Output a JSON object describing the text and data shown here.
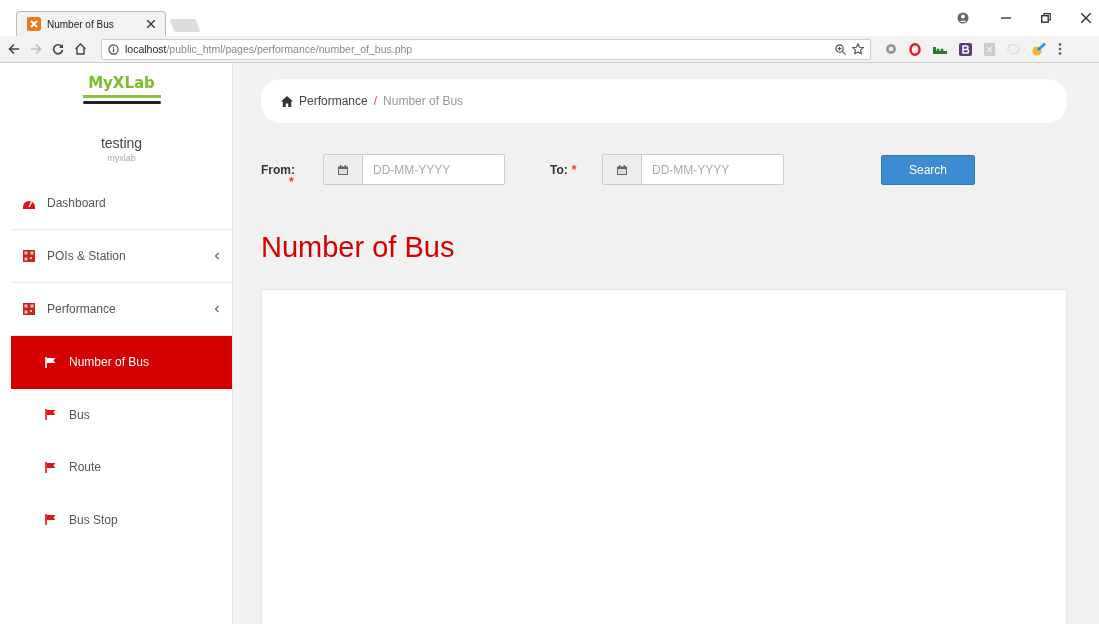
{
  "browser": {
    "tab_title": "Number of Bus",
    "url_host": "localhost",
    "url_path": "/public_html/pages/performance/number_of_bus.php"
  },
  "sidebar": {
    "logo": "MyXLab",
    "user_name": "testing",
    "user_org": "myxlab",
    "items": [
      {
        "label": "Dashboard",
        "kind": "dashboard"
      },
      {
        "label": "POIs & Station",
        "kind": "group"
      },
      {
        "label": "Performance",
        "kind": "group",
        "children": [
          {
            "label": "Number of Bus",
            "selected": true
          },
          {
            "label": "Bus",
            "selected": false
          },
          {
            "label": "Route",
            "selected": false
          },
          {
            "label": "Bus Stop",
            "selected": false
          }
        ]
      }
    ]
  },
  "breadcrumb": [
    "Performance",
    "Number of Bus"
  ],
  "breadcrumb_separator": "/",
  "filter": {
    "from_label": "From:",
    "from_placeholder": "DD-MM-YYYY",
    "to_label": "To:",
    "to_placeholder": "DD-MM-YYYY",
    "required_mark": "*",
    "search_button": "Search"
  },
  "page_title": "Number of Bus"
}
